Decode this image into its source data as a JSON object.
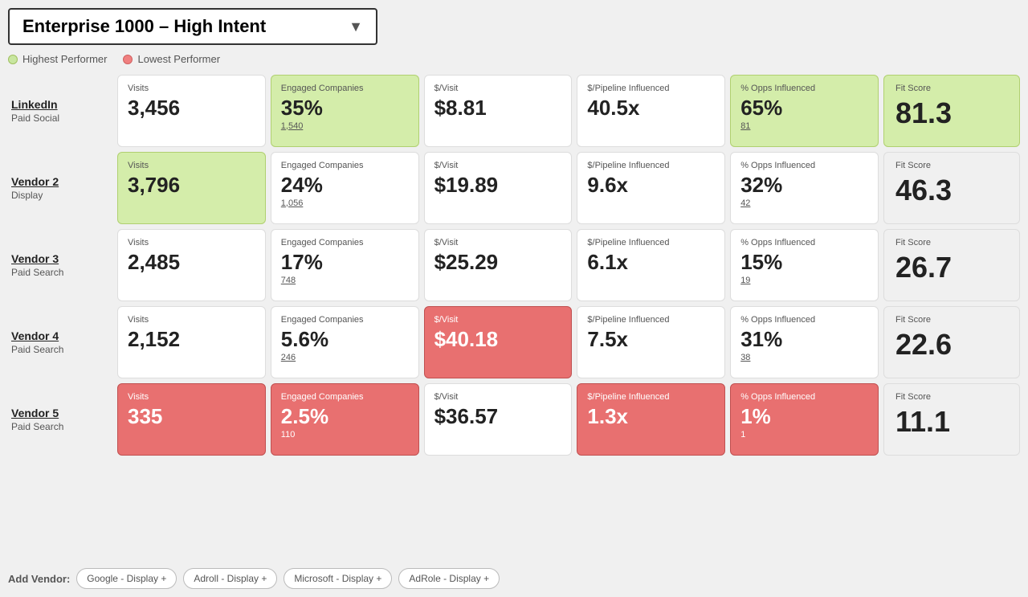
{
  "header": {
    "dropdown_label": "Enterprise 1000 – High Intent",
    "dropdown_arrow": "▼"
  },
  "legend": {
    "highest_label": "Highest Performer",
    "lowest_label": "Lowest Performer"
  },
  "columns": {
    "visits": "Visits",
    "engaged": "Engaged Companies",
    "cost_per_visit": "$/Visit",
    "pipeline": "$/Pipeline Influenced",
    "opps": "% Opps Influenced",
    "fit_score": "Fit Score"
  },
  "vendors": [
    {
      "name": "LinkedIn",
      "type": "Paid Social",
      "visits": {
        "value": "3,456",
        "highlight": "none"
      },
      "engaged": {
        "value": "35%",
        "sub": "1,540",
        "highlight": "green"
      },
      "cost_per_visit": {
        "value": "$8.81",
        "highlight": "none"
      },
      "pipeline": {
        "value": "40.5x",
        "highlight": "none"
      },
      "opps": {
        "value": "65%",
        "sub": "81",
        "highlight": "green"
      },
      "fit_score": {
        "value": "81.3",
        "highlight": "green"
      }
    },
    {
      "name": "Vendor 2",
      "type": "Display",
      "visits": {
        "value": "3,796",
        "highlight": "green"
      },
      "engaged": {
        "value": "24%",
        "sub": "1,056",
        "highlight": "none"
      },
      "cost_per_visit": {
        "value": "$19.89",
        "highlight": "none"
      },
      "pipeline": {
        "value": "9.6x",
        "highlight": "none"
      },
      "opps": {
        "value": "32%",
        "sub": "42",
        "highlight": "none"
      },
      "fit_score": {
        "value": "46.3",
        "highlight": "none"
      }
    },
    {
      "name": "Vendor 3",
      "type": "Paid Search",
      "visits": {
        "value": "2,485",
        "highlight": "none"
      },
      "engaged": {
        "value": "17%",
        "sub": "748",
        "highlight": "none"
      },
      "cost_per_visit": {
        "value": "$25.29",
        "highlight": "none"
      },
      "pipeline": {
        "value": "6.1x",
        "highlight": "none"
      },
      "opps": {
        "value": "15%",
        "sub": "19",
        "highlight": "none"
      },
      "fit_score": {
        "value": "26.7",
        "highlight": "none"
      }
    },
    {
      "name": "Vendor 4",
      "type": "Paid Search",
      "visits": {
        "value": "2,152",
        "highlight": "none"
      },
      "engaged": {
        "value": "5.6%",
        "sub": "246",
        "highlight": "none"
      },
      "cost_per_visit": {
        "value": "$40.18",
        "highlight": "red"
      },
      "pipeline": {
        "value": "7.5x",
        "highlight": "none"
      },
      "opps": {
        "value": "31%",
        "sub": "38",
        "highlight": "none"
      },
      "fit_score": {
        "value": "22.6",
        "highlight": "none"
      }
    },
    {
      "name": "Vendor 5",
      "type": "Paid Search",
      "visits": {
        "value": "335",
        "highlight": "red"
      },
      "engaged": {
        "value": "2.5%",
        "sub": "110",
        "highlight": "red"
      },
      "cost_per_visit": {
        "value": "$36.57",
        "highlight": "none"
      },
      "pipeline": {
        "value": "1.3x",
        "highlight": "red"
      },
      "opps": {
        "value": "1%",
        "sub": "1",
        "highlight": "red"
      },
      "fit_score": {
        "value": "11.1",
        "highlight": "none"
      }
    }
  ],
  "footer": {
    "add_vendor_label": "Add Vendor:",
    "tags": [
      "Google - Display +",
      "Adroll - Display +",
      "Microsoft - Display +",
      "AdRole - Display +"
    ]
  }
}
